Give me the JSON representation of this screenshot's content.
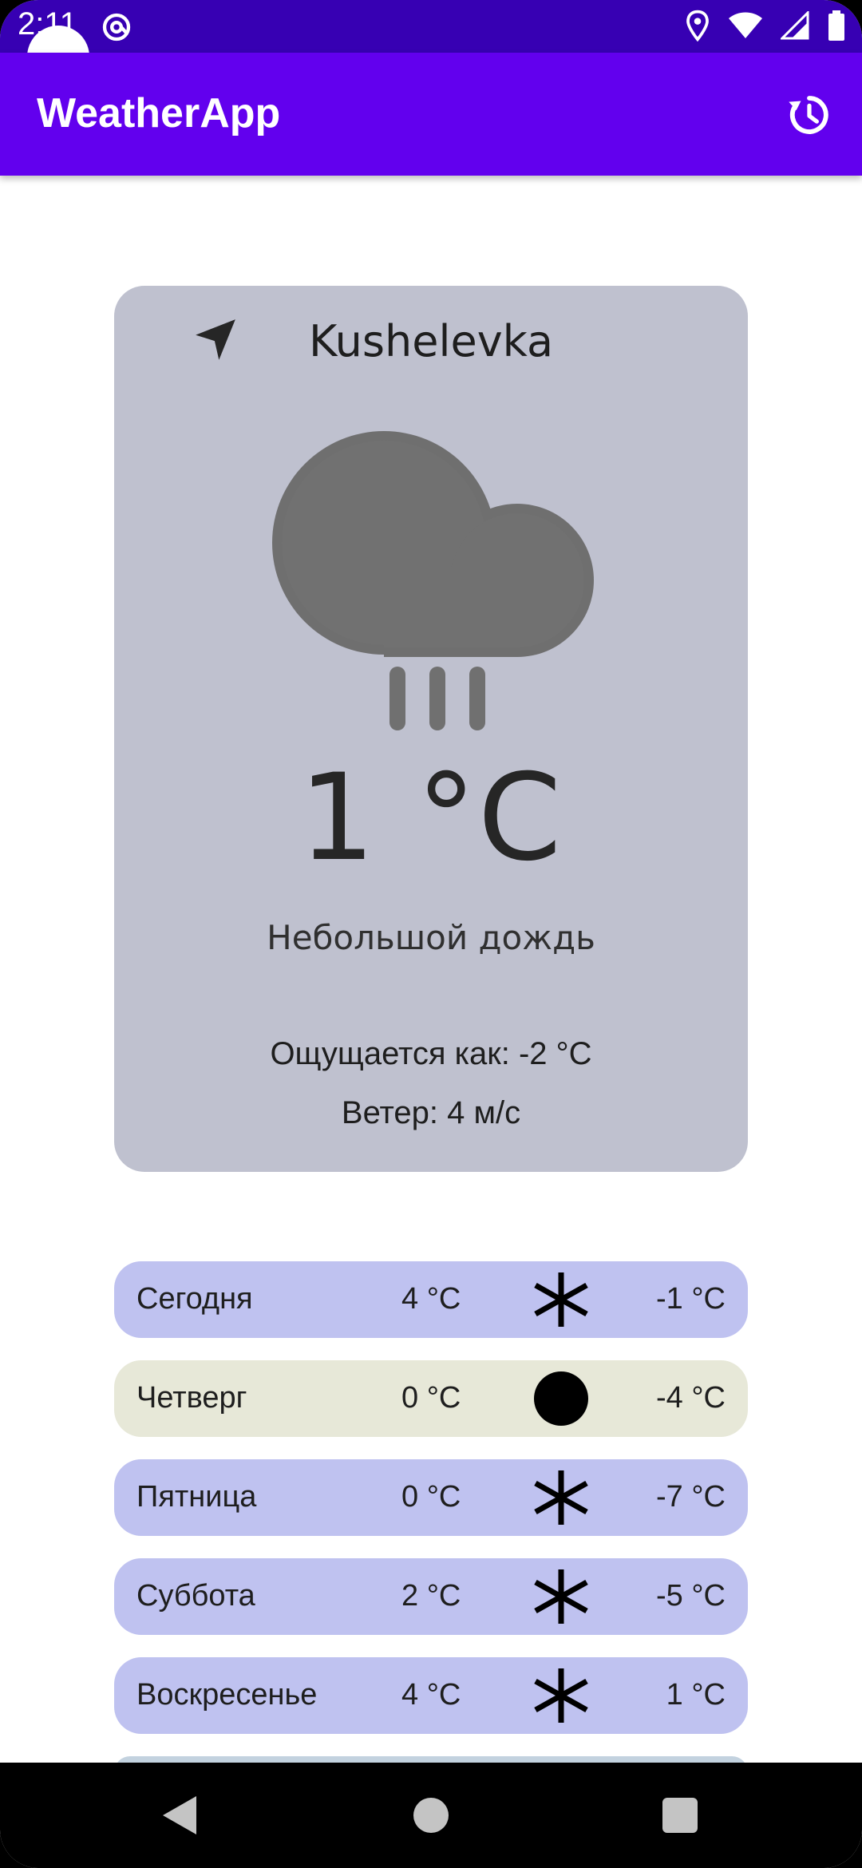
{
  "status_bar": {
    "time": "2:11",
    "icons": [
      "at-icon",
      "location-pin-icon",
      "wifi-icon",
      "signal-icon",
      "battery-icon"
    ]
  },
  "app_bar": {
    "title": "WeatherApp",
    "action_icon": "refresh-history-icon"
  },
  "current": {
    "city": "Kushelevka",
    "location_icon": "navigation-arrow-icon",
    "condition_icon": "rain-cloud-icon",
    "temperature": "1 °C",
    "description": "Небольшой дождь",
    "feels_like": "Ощущается как: -2 °C",
    "wind": "Ветер: 4 м/с"
  },
  "forecast": [
    {
      "day": "Сегодня",
      "high": "4 °C",
      "icon": "snowflake-icon",
      "low": "-1 °C"
    },
    {
      "day": "Четверг",
      "high": "0 °C",
      "icon": "full-moon-icon",
      "low": "-4 °C"
    },
    {
      "day": "Пятница",
      "high": "0 °C",
      "icon": "snowflake-icon",
      "low": "-7 °C"
    },
    {
      "day": "Суббота",
      "high": "2 °C",
      "icon": "snowflake-icon",
      "low": "-5 °C"
    },
    {
      "day": "Воскресенье",
      "high": "4 °C",
      "icon": "snowflake-icon",
      "low": "1 °C"
    }
  ],
  "colors": {
    "status_bar": "#3700b3",
    "app_bar": "#6200ee",
    "card": "#bfc1cf",
    "row_default": "#bfc2f0",
    "row_highlight": "#e7e8d8"
  },
  "nav_bar": {
    "icons": [
      "back-icon",
      "home-icon",
      "recents-icon"
    ]
  }
}
